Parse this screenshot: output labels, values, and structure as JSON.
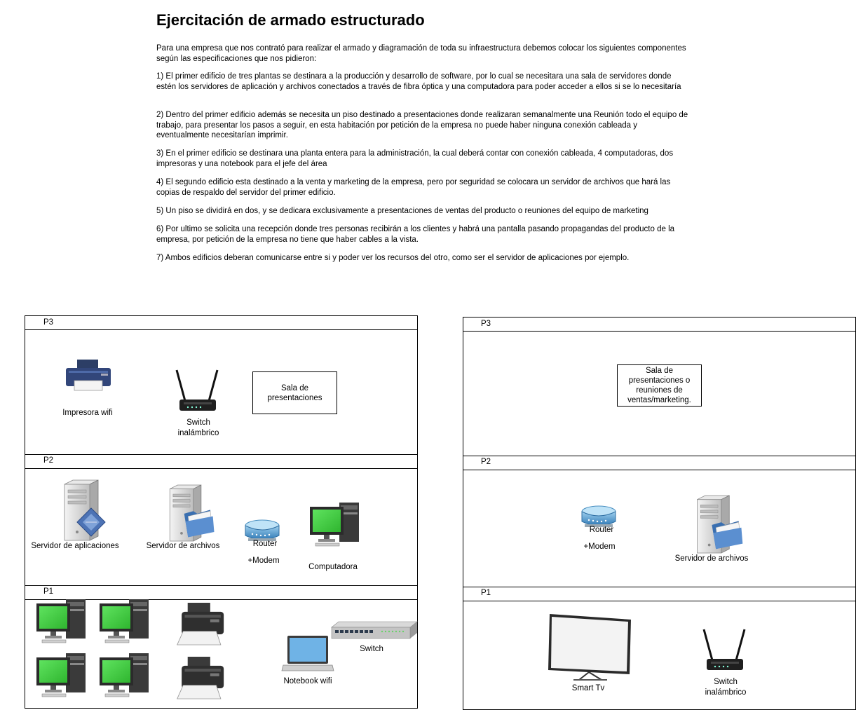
{
  "header": {
    "title": "Ejercitación de armado estructurado",
    "intro": "Para una empresa que  nos contrató para realizar el armado y diagramación de toda su infraestructura debemos colocar los siguientes componentes según las especificaciones que nos pidieron:",
    "items": [
      "1) El primer edificio de tres plantas se destinara a la producción y desarrollo de software, por lo cual se necesitara una sala de servidores donde estén los servidores de aplicación y archivos conectados a través de fibra óptica y una computadora para poder acceder a ellos si se lo necesitaría",
      "2) Dentro del primer edificio además se necesita un piso destinado a presentaciones donde realizaran semanalmente una Reunión todo el equipo de trabajo, para presentar los pasos a seguir, en esta habitación por petición de la empresa no puede haber ninguna conexión cableada y eventualmente necesitarían imprimir.",
      "3) En el primer edificio se destinara una planta entera para la administración, la cual deberá contar con conexión cableada, 4 computadoras, dos impresoras y una notebook para el jefe del área",
      "4) El segundo edificio esta destinado a la venta y marketing de la empresa, pero por seguridad se colocara un servidor de archivos que hará las copias de respaldo del servidor del primer edificio.",
      "5) Un piso se dividirá en dos, y se dedicara exclusivamente a presentaciones de ventas del producto o reuniones del equipo de marketing",
      "6) Por ultimo se solicita una recepción donde tres personas recibirán a los clientes y habrá una pantalla pasando propagandas del producto de la empresa, por petición de la empresa no tiene que haber cables a la vista.",
      "7) Ambos edificios deberan comunicarse entre si y poder ver los recursos del otro, como ser el servidor de aplicaciones por ejemplo."
    ]
  },
  "building1": {
    "p3": {
      "label": "P3",
      "printer": "Impresora wifi",
      "switch_line1": "Switch",
      "switch_line2": "inalámbrico",
      "room": "Sala de presentaciones"
    },
    "p2": {
      "label": "P2",
      "app_server": "Servidor de aplicaciones",
      "file_server": "Servidor de archivos",
      "router": "Router",
      "modem": "+Modem",
      "computer": "Computadora"
    },
    "p1": {
      "label": "P1",
      "notebook": "Notebook wifi",
      "switch": "Switch"
    }
  },
  "building2": {
    "p3": {
      "label": "P3",
      "room": "Sala de presentaciones o reuniones de ventas/marketing."
    },
    "p2": {
      "label": "P2",
      "router": "Router",
      "modem": "+Modem",
      "file_server": "Servidor de archivos"
    },
    "p1": {
      "label": "P1",
      "tv": "Smart Tv",
      "switch_line1": "Switch",
      "switch_line2": "inalámbrico"
    }
  },
  "colors": {
    "screen_green": "#3fd13f",
    "router_blue": "#5aa0d0",
    "server_gray": "#d9d9d9",
    "printer_navy": "#2c3e66"
  }
}
